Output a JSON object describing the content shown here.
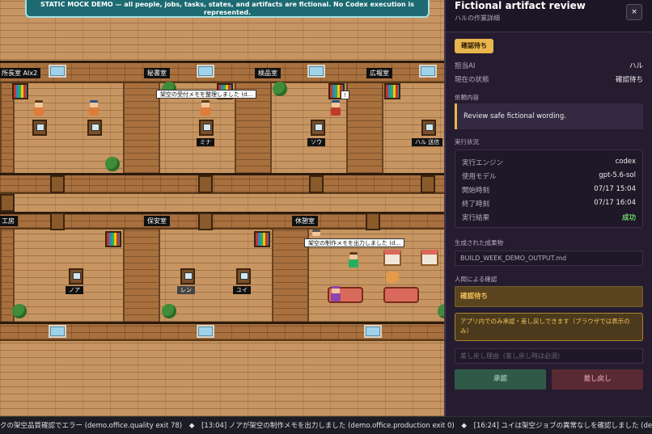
{
  "banner": {
    "text": "STATIC MOCK DEMO — all people, jobs, tasks, states, and artifacts are fictional. No Codex execution is represented."
  },
  "rooms": {
    "labels": [
      "所長室 AIx2",
      "秘書室",
      "検品室",
      "広報室",
      "工房",
      "保安室",
      "休憩室"
    ]
  },
  "agents": {
    "names": [
      "ミナ",
      "ソウ",
      "ハル 送信",
      "ノア",
      "レン",
      "ユイ"
    ]
  },
  "speech": {
    "bubble1": "架空の受付メモを整理しました (d…",
    "bubble2": "架空の制作メモを出力しました (d…",
    "alert": "!"
  },
  "ticker": {
    "items": [
      "クの架空品質確認でエラー (demo.office.quality exit 78)",
      "[13:04] ノアが架空の制作メモを出力しました (demo.office.production exit 0)",
      "[16:24] ユイは架空ジョブの異常なしを確認しました (demo.office."
    ],
    "separator": "◆"
  },
  "panel": {
    "title": "Fictional artifact review",
    "subtitle": "ハルの作業詳細",
    "close_label": "×",
    "status_badge": "確認待ち",
    "assignee_key": "担当AI",
    "assignee_value": "ハル",
    "state_key": "現在の状態",
    "state_value": "確認待ち",
    "request_title": "依頼内容",
    "request_text": "Review safe fictional wording.",
    "exec_title": "実行状況",
    "exec": {
      "engine_key": "実行エンジン",
      "engine_value": "codex",
      "model_key": "使用モデル",
      "model_value": "gpt-5.6-sol",
      "start_key": "開始時刻",
      "start_value": "07/17 15:04",
      "end_key": "終了時刻",
      "end_value": "07/17 16:04",
      "result_key": "実行結果",
      "result_value": "成功"
    },
    "artifact_title": "生成された成果物",
    "artifact_name": "BUILD_WEEK_DEMO_OUTPUT.md",
    "human_title": "人間による確認",
    "human_state": "確認待ち",
    "note": "アプリ内でのみ承認・差し戻しできます（ブラウザでは表示のみ）",
    "reason_placeholder": "差し戻し理由（差し戻し時は必須）",
    "approve_label": "承認",
    "reject_label": "差し戻し"
  },
  "colors": {
    "accent": "#e9b54d",
    "success": "#6ad36a",
    "panel_bg": "#261c30",
    "banner_bg": "#1d6a72"
  }
}
